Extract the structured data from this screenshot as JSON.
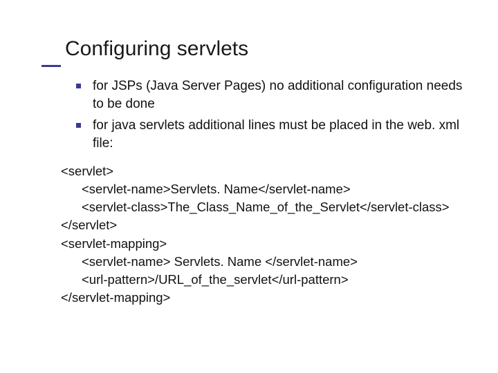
{
  "title": "Configuring servlets",
  "bullets": [
    "for JSPs (Java Server Pages) no additional configuration needs to be done",
    "for java servlets additional lines must be placed in the web. xml file:"
  ],
  "code_lines": [
    {
      "text": "<servlet>",
      "indent": 0
    },
    {
      "text": "<servlet-name>Servlets. Name</servlet-name>",
      "indent": 1
    },
    {
      "text": "<servlet-class>The_Class_Name_of_the_Servlet</servlet-class>",
      "indent": 1
    },
    {
      "text": "</servlet>",
      "indent": 0
    },
    {
      "text": "<servlet-mapping>",
      "indent": 0
    },
    {
      "text": "<servlet-name> Servlets. Name </servlet-name>",
      "indent": 1
    },
    {
      "text": "<url-pattern>/URL_of_the_servlet</url-pattern>",
      "indent": 1
    },
    {
      "text": "</servlet-mapping>",
      "indent": 0
    }
  ]
}
